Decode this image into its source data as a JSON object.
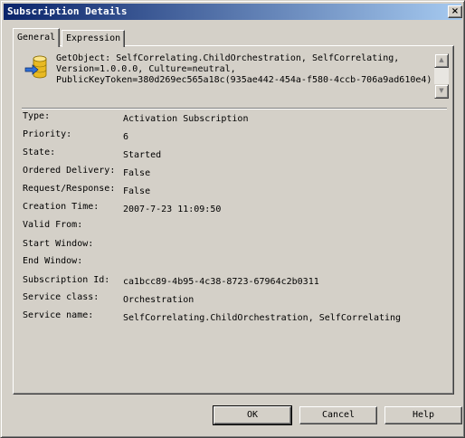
{
  "window": {
    "title": "Subscription Details",
    "close_label": "×"
  },
  "tabs": [
    {
      "label": "General",
      "active": true
    },
    {
      "label": "Expression",
      "active": false
    }
  ],
  "object": {
    "icon": "orchestration-database-icon",
    "lines": [
      "GetObject: SelfCorrelating.ChildOrchestration, SelfCorrelating,",
      "Version=1.0.0.0, Culture=neutral,",
      "PublicKeyToken=380d269ec565a18c(935ae442-454a-f580-4ccb-706a9ad610e4)"
    ]
  },
  "scrollbar": {
    "up": "▲",
    "down": "▼"
  },
  "properties": [
    {
      "label": "Type:",
      "value": "Activation Subscription"
    },
    {
      "label": "Priority:",
      "value": "6"
    },
    {
      "label": "State:",
      "value": "Started"
    },
    {
      "label": "Ordered Delivery:",
      "value": "False"
    },
    {
      "label": "Request/Response:",
      "value": "False"
    },
    {
      "label": "Creation Time:",
      "value": "2007-7-23 11:09:50"
    },
    {
      "label": "Valid From:",
      "value": ""
    },
    {
      "label": "Start Window:",
      "value": ""
    },
    {
      "label": "End Window:",
      "value": ""
    },
    {
      "label": "Subscription Id:",
      "value": "ca1bcc89-4b95-4c38-8723-67964c2b0311"
    },
    {
      "label": "Service class:",
      "value": "Orchestration"
    },
    {
      "label": "Service name:",
      "value": "SelfCorrelating.ChildOrchestration, SelfCorrelating"
    }
  ],
  "buttons": {
    "ok": "OK",
    "cancel": "Cancel",
    "help": "Help"
  },
  "colors": {
    "titlebar_start": "#0a246a",
    "titlebar_end": "#a6caf0",
    "face": "#d4d0c8"
  }
}
